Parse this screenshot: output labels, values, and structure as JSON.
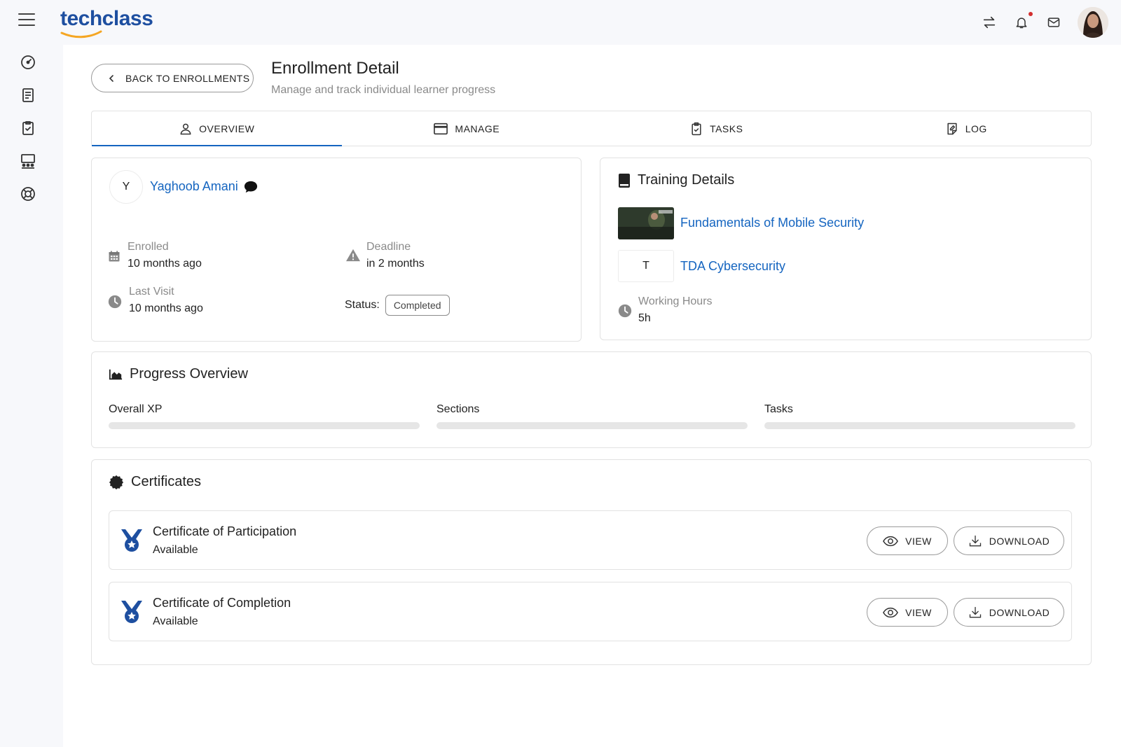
{
  "app": {
    "logo_text": "techclass"
  },
  "header": {
    "title": "Enrollment Detail",
    "subtitle": "Manage and track individual learner progress",
    "back_label": "BACK TO ENROLLMENTS"
  },
  "tabs": [
    {
      "label": "OVERVIEW",
      "icon": "person-icon",
      "active": true
    },
    {
      "label": "MANAGE",
      "icon": "calendar-window-icon",
      "active": false
    },
    {
      "label": "TASKS",
      "icon": "clipboard-check-icon",
      "active": false
    },
    {
      "label": "LOG",
      "icon": "note-edit-icon",
      "active": false
    }
  ],
  "learner": {
    "initial": "Y",
    "name": "Yaghoob Amani",
    "enrolled_label": "Enrolled",
    "enrolled_value": "10 months ago",
    "deadline_label": "Deadline",
    "deadline_value": "in 2 months",
    "last_visit_label": "Last Visit",
    "last_visit_value": "10 months ago",
    "status_label": "Status:",
    "status_value": "Completed"
  },
  "training": {
    "title": "Training Details",
    "course_name": "Fundamentals of Mobile Security",
    "provider_initial": "T",
    "provider_name": "TDA Cybersecurity",
    "hours_label": "Working Hours",
    "hours_value": "5h"
  },
  "progress": {
    "title": "Progress Overview",
    "items": [
      {
        "label": "Overall XP",
        "value": 0
      },
      {
        "label": "Sections",
        "value": 0
      },
      {
        "label": "Tasks",
        "value": 0
      }
    ]
  },
  "certificates": {
    "title": "Certificates",
    "view_label": "VIEW",
    "download_label": "DOWNLOAD",
    "items": [
      {
        "name": "Certificate of Participation",
        "status": "Available"
      },
      {
        "name": "Certificate of Completion",
        "status": "Available"
      }
    ]
  },
  "colors": {
    "accent": "#1565c0",
    "brand": "#1e4fa0",
    "brand_swoosh": "#f5a623",
    "notification_dot": "#d32f2f"
  }
}
